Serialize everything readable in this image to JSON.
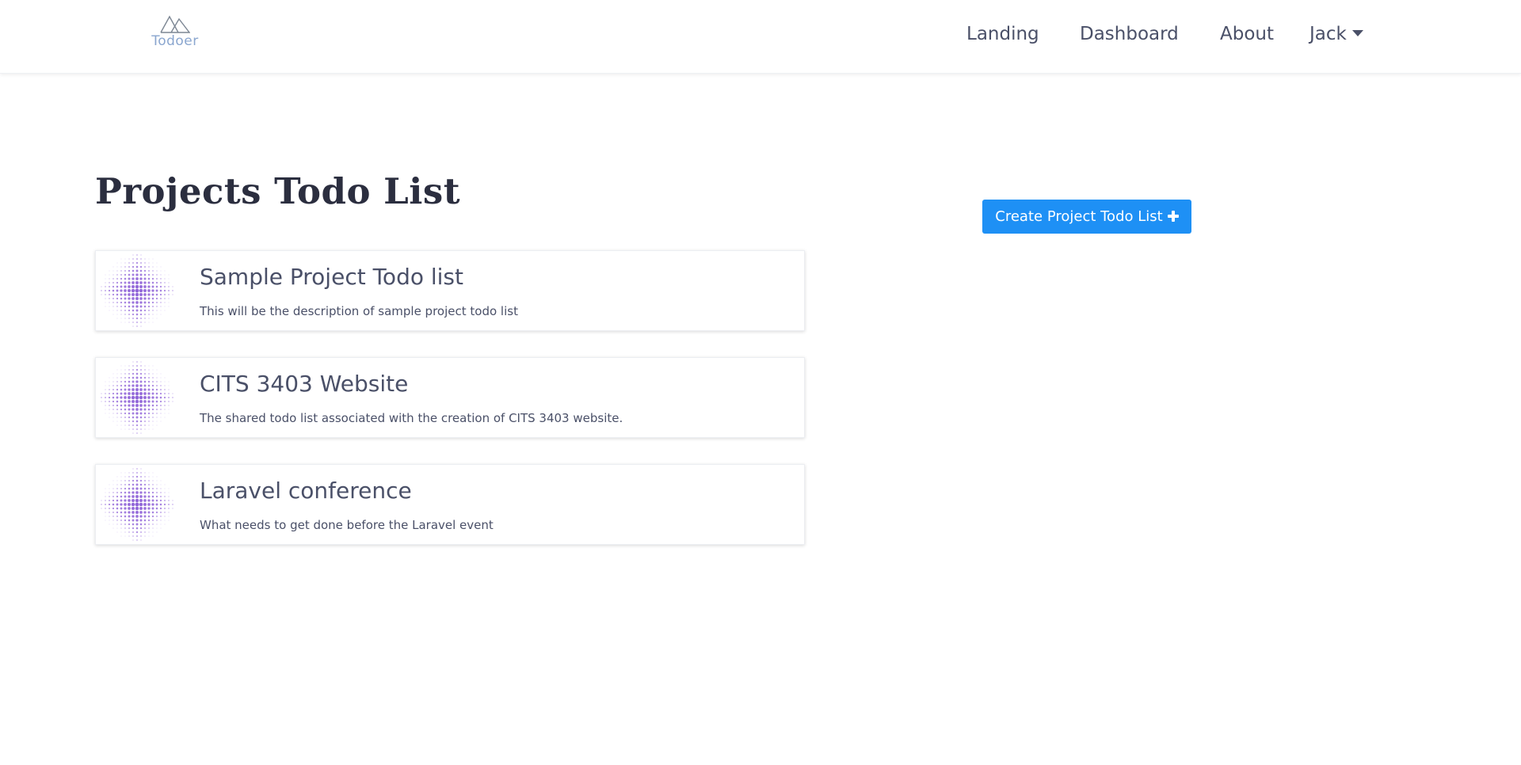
{
  "brand": {
    "name": "Todoer",
    "icon": "mountain-logo-icon"
  },
  "nav": {
    "links": [
      {
        "label": "Landing"
      },
      {
        "label": "Dashboard"
      },
      {
        "label": "About"
      }
    ],
    "user": {
      "label": "Jack",
      "icon": "caret-down-icon"
    }
  },
  "main": {
    "title": "Projects Todo List",
    "create_button": {
      "label": "Create Project Todo List",
      "icon": "plus-icon"
    },
    "projects": [
      {
        "title": "Sample Project Todo list",
        "description": "This will be the description of sample project todo list"
      },
      {
        "title": "CITS 3403 Website",
        "description": "The shared todo list associated with the creation of CITS 3403 website."
      },
      {
        "title": "Laravel conference",
        "description": "What needs to get done before the Laravel event"
      }
    ]
  },
  "colors": {
    "accent": "#1e90f5",
    "heading": "#2b2e3f",
    "text": "#4a5068",
    "brand": "#8aa6cf",
    "thumb_purple": "#8a5cd6"
  }
}
